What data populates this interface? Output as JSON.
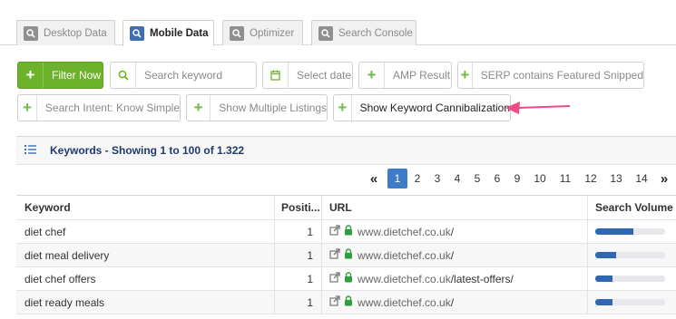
{
  "tabs": [
    {
      "label": "Desktop Data",
      "active": false
    },
    {
      "label": "Mobile Data",
      "active": true
    },
    {
      "label": "Optimizer",
      "active": false
    },
    {
      "label": "Search Console",
      "active": false
    }
  ],
  "filters": {
    "filter_now": "Filter Now",
    "search_placeholder": "Search keyword",
    "select_date": "Select date",
    "amp_result": "AMP Result",
    "serp_featured": "SERP contains Featured Snipped",
    "search_intent": "Search Intent: Know Simple",
    "multiple_listings": "Show Multiple Listings",
    "cannibalization": "Show Keyword Cannibalization"
  },
  "keywords_panel": {
    "title": "Keywords - Showing 1 to 100 of 1.322"
  },
  "pagination": {
    "prev": "«",
    "next": "»",
    "pages": [
      "1",
      "2",
      "3",
      "4",
      "5",
      "6",
      "9",
      "10",
      "11",
      "12",
      "13",
      "14"
    ],
    "current": "1"
  },
  "table": {
    "headers": {
      "keyword": "Keyword",
      "position": "Positi...",
      "url": "URL",
      "volume": "Search Volume"
    },
    "rows": [
      {
        "keyword": "diet chef",
        "position": "1",
        "url_domain": "www.dietchef.co.uk",
        "url_path": "/",
        "volume": 0.55
      },
      {
        "keyword": "diet meal delivery",
        "position": "1",
        "url_domain": "www.dietchef.co.uk",
        "url_path": "/",
        "volume": 0.3
      },
      {
        "keyword": "diet chef offers",
        "position": "1",
        "url_domain": "www.dietchef.co.uk",
        "url_path": "/latest-offers/",
        "volume": 0.25
      },
      {
        "keyword": "diet ready meals",
        "position": "1",
        "url_domain": "www.dietchef.co.uk",
        "url_path": "/",
        "volume": 0.25
      }
    ]
  },
  "colors": {
    "accent_green": "#6cb32b",
    "accent_blue": "#3e7cc9",
    "lock_green": "#2e9e3e",
    "arrow_pink": "#ec4a8a"
  }
}
